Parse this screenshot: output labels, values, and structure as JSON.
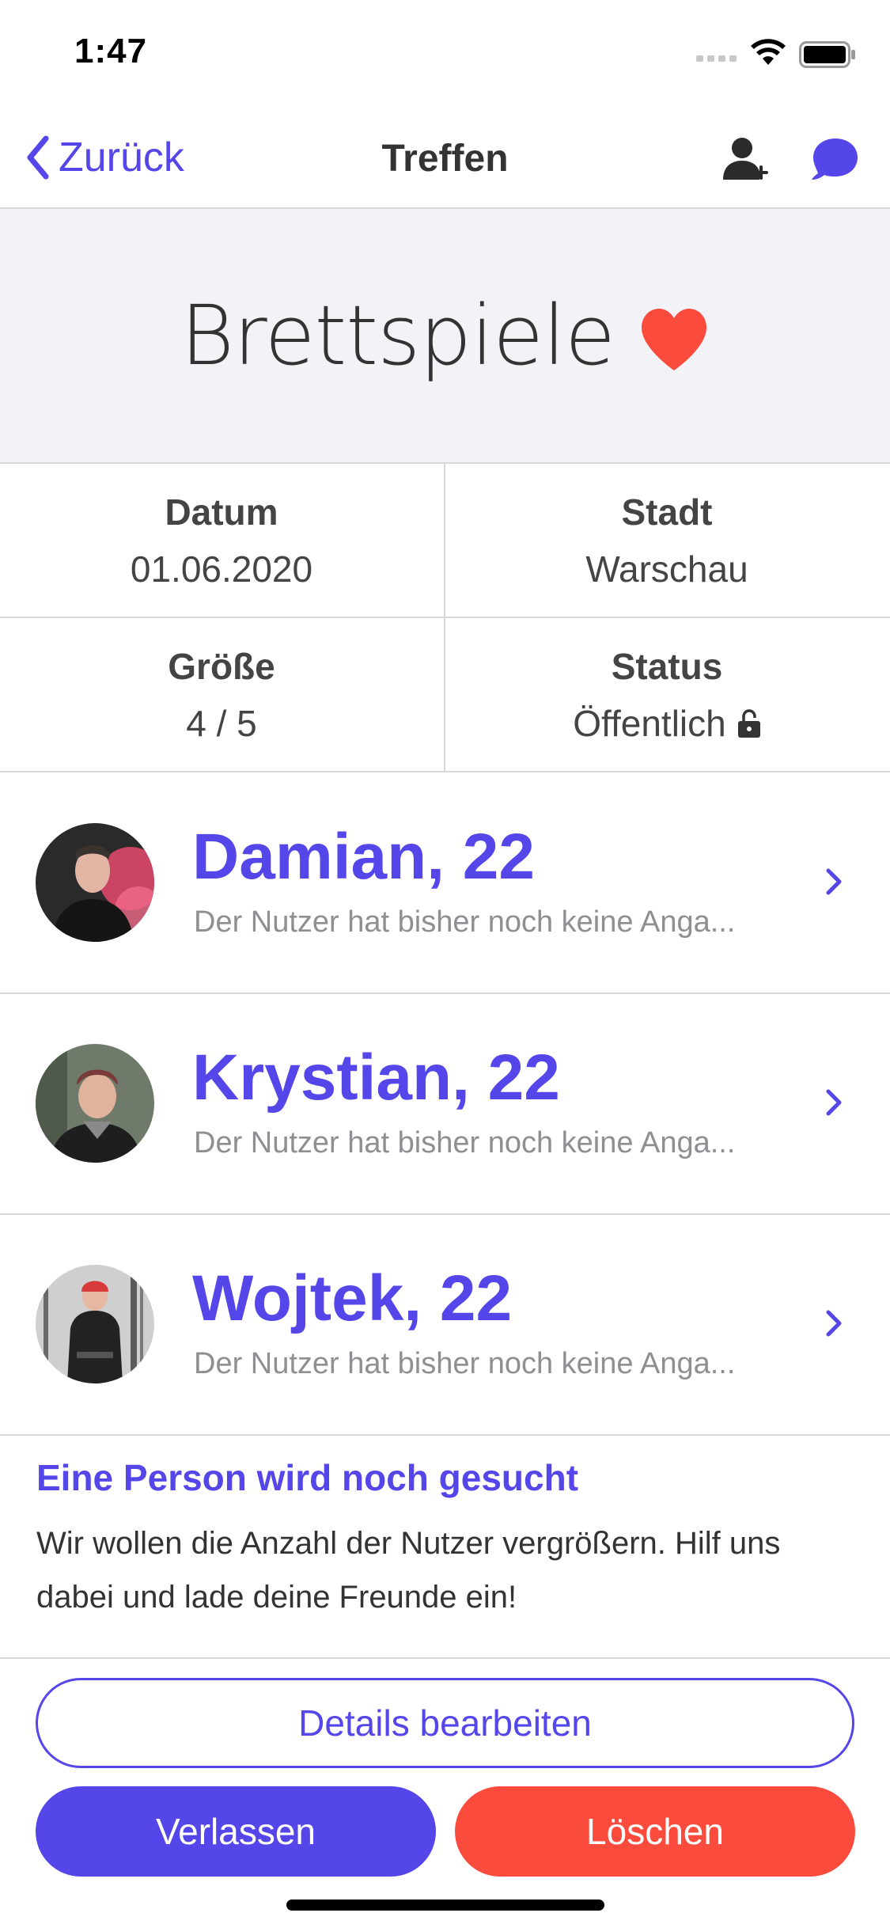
{
  "status_bar": {
    "time": "1:47",
    "icons": [
      "signal-icon",
      "wifi-icon",
      "battery-icon"
    ]
  },
  "navbar": {
    "back_label": "Zurück",
    "title": "Treffen",
    "icons": [
      "add-user-icon",
      "chat-icon"
    ]
  },
  "hero": {
    "title": "Brettspiele",
    "icon": "heart-icon"
  },
  "info": {
    "date_label": "Datum",
    "date_value": "01.06.2020",
    "city_label": "Stadt",
    "city_value": "Warschau",
    "size_label": "Größe",
    "size_value": "4 / 5",
    "status_label": "Status",
    "status_value": "Öffentlich"
  },
  "members": [
    {
      "name": "Damian, 22",
      "description": "Der Nutzer hat bisher noch keine Anga..."
    },
    {
      "name": "Krystian, 22",
      "description": "Der Nutzer hat bisher noch keine Anga..."
    },
    {
      "name": "Wojtek, 22",
      "description": "Der Nutzer hat bisher noch keine Anga..."
    }
  ],
  "invite": {
    "title": "Eine Person wird noch gesucht",
    "text": "Wir wollen die Anzahl der Nutzer vergrößern. Hilf uns dabei und lade deine Freunde ein!"
  },
  "actions": {
    "edit_label": "Details bearbeiten",
    "leave_label": "Verlassen",
    "delete_label": "Löschen"
  },
  "colors": {
    "accent": "#5446e8",
    "danger": "#fa4b3c",
    "heart": "#fa4b3c",
    "hero_bg": "#f2f2f7"
  }
}
